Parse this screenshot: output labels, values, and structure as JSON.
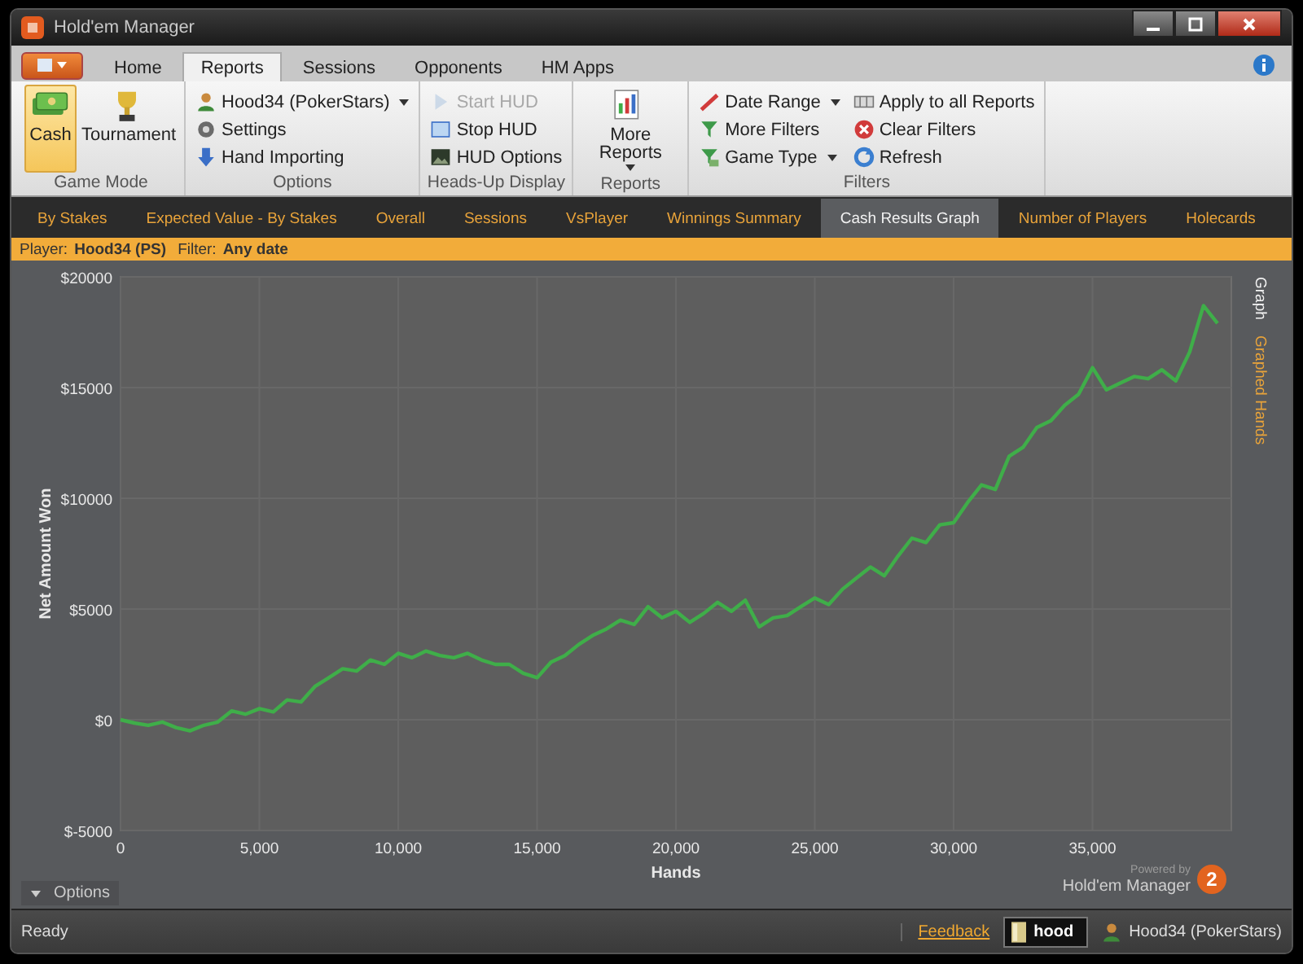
{
  "window": {
    "title": "Hold'em Manager"
  },
  "ribbon_tabs": [
    {
      "label": "Home",
      "selected": false
    },
    {
      "label": "Reports",
      "selected": true
    },
    {
      "label": "Sessions",
      "selected": false
    },
    {
      "label": "Opponents",
      "selected": false
    },
    {
      "label": "HM Apps",
      "selected": false
    }
  ],
  "ribbon_groups": [
    {
      "label": "Game Mode",
      "kind": "large",
      "items": [
        {
          "label": "Cash",
          "selected": true
        },
        {
          "label": "Tournament",
          "selected": false
        }
      ]
    },
    {
      "label": "Options",
      "kind": "small",
      "items": [
        {
          "label": "Hood34 (PokerStars)",
          "dropdown": true,
          "disabled": false
        },
        {
          "label": "Settings",
          "dropdown": false,
          "disabled": false
        },
        {
          "label": "Hand Importing",
          "dropdown": false,
          "disabled": false
        }
      ]
    },
    {
      "label": "Heads-Up Display",
      "kind": "small",
      "items": [
        {
          "label": "Start HUD",
          "dropdown": false,
          "disabled": true
        },
        {
          "label": "Stop HUD",
          "dropdown": false,
          "disabled": false
        },
        {
          "label": "HUD Options",
          "dropdown": false,
          "disabled": false
        }
      ]
    },
    {
      "label": "Reports",
      "kind": "large",
      "items": [
        {
          "label": "More Reports",
          "dropdown": true,
          "selected": false
        }
      ]
    },
    {
      "label": "Filters",
      "kind": "small",
      "items": [
        {
          "label": "Date Range",
          "dropdown": true,
          "disabled": false
        },
        {
          "label": "More Filters",
          "dropdown": false,
          "disabled": false
        },
        {
          "label": "Game Type",
          "dropdown": true,
          "disabled": false
        },
        {
          "label": "Apply to all Reports",
          "dropdown": false,
          "disabled": false
        },
        {
          "label": "Clear Filters",
          "dropdown": false,
          "disabled": false
        },
        {
          "label": "Refresh",
          "dropdown": false,
          "disabled": false
        }
      ]
    }
  ],
  "report_tabs": [
    {
      "label": "By Stakes",
      "selected": false
    },
    {
      "label": "Expected Value - By Stakes",
      "selected": false
    },
    {
      "label": "Overall",
      "selected": false
    },
    {
      "label": "Sessions",
      "selected": false
    },
    {
      "label": "VsPlayer",
      "selected": false
    },
    {
      "label": "Winnings Summary",
      "selected": false
    },
    {
      "label": "Cash Results Graph",
      "selected": true
    },
    {
      "label": "Number of Players",
      "selected": false
    },
    {
      "label": "Holecards",
      "selected": false
    }
  ],
  "filter_bar": {
    "player_label": "Player:",
    "player": "Hood34 (PS)",
    "filter_label": "Filter:",
    "filter": "Any date"
  },
  "graph": {
    "chart_data": {
      "type": "line",
      "grid": true,
      "xlabel": "Hands",
      "ylabel": "Net Amount Won",
      "xlim": [
        0,
        40000
      ],
      "ylim": [
        -5000,
        20000
      ],
      "xticks": [
        {
          "value": 0,
          "label": "0"
        },
        {
          "value": 5000,
          "label": "5,000"
        },
        {
          "value": 10000,
          "label": "10,000"
        },
        {
          "value": 15000,
          "label": "15,000"
        },
        {
          "value": 20000,
          "label": "20,000"
        },
        {
          "value": 25000,
          "label": "25,000"
        },
        {
          "value": 30000,
          "label": "30,000"
        },
        {
          "value": 35000,
          "label": "35,000"
        }
      ],
      "yticks": [
        {
          "value": -5000,
          "label": "$-5000"
        },
        {
          "value": 0,
          "label": "$0"
        },
        {
          "value": 5000,
          "label": "$5000"
        },
        {
          "value": 10000,
          "label": "$10000"
        },
        {
          "value": 15000,
          "label": "$15000"
        },
        {
          "value": 20000,
          "label": "$20000"
        }
      ],
      "x": [
        0,
        500,
        1000,
        1500,
        2000,
        2500,
        3000,
        3500,
        4000,
        4500,
        5000,
        5500,
        6000,
        6500,
        7000,
        7500,
        8000,
        8500,
        9000,
        9500,
        10000,
        10500,
        11000,
        11500,
        12000,
        12500,
        13000,
        13500,
        14000,
        14500,
        15000,
        15500,
        16000,
        16500,
        17000,
        17500,
        18000,
        18500,
        19000,
        19500,
        20000,
        20500,
        21000,
        21500,
        22000,
        22500,
        23000,
        23500,
        24000,
        24500,
        25000,
        25500,
        26000,
        26500,
        27000,
        27500,
        28000,
        28500,
        29000,
        29500,
        30000,
        30500,
        31000,
        31500,
        32000,
        32500,
        33000,
        33500,
        34000,
        34500,
        35000,
        35500,
        36000,
        36500,
        37000,
        37500,
        38000,
        38500,
        39000,
        39500
      ],
      "series": [
        {
          "color": "#3fae49",
          "values": [
            0,
            -150,
            -250,
            -100,
            -350,
            -500,
            -250,
            -100,
            400,
            250,
            500,
            350,
            900,
            800,
            1500,
            1900,
            2300,
            2200,
            2700,
            2500,
            3000,
            2800,
            3100,
            2900,
            2800,
            3000,
            2700,
            2500,
            2500,
            2100,
            1900,
            2600,
            2900,
            3400,
            3800,
            4100,
            4500,
            4300,
            5100,
            4600,
            4900,
            4400,
            4800,
            5300,
            4900,
            5400,
            4200,
            4600,
            4700,
            5100,
            5500,
            5200,
            5900,
            6400,
            6900,
            6500,
            7400,
            8200,
            8000,
            8800,
            8900,
            9800,
            10600,
            10400,
            11900,
            12300,
            13200,
            13500,
            14200,
            14700,
            15900,
            14900,
            15200,
            15500,
            15400,
            15800,
            15300,
            16600,
            18700,
            17900
          ]
        }
      ]
    },
    "side_tabs": [
      {
        "label": "Graph",
        "selected": true
      },
      {
        "label": "Graphed Hands",
        "selected": false
      }
    ],
    "options_button": "Options",
    "powered_by": {
      "caption": "Powered by",
      "product": "Hold'em Manager",
      "logo_text": "2"
    }
  },
  "status_bar": {
    "status": "Ready",
    "feedback_link": "Feedback",
    "user": "hood",
    "player": "Hood34 (PokerStars)"
  }
}
